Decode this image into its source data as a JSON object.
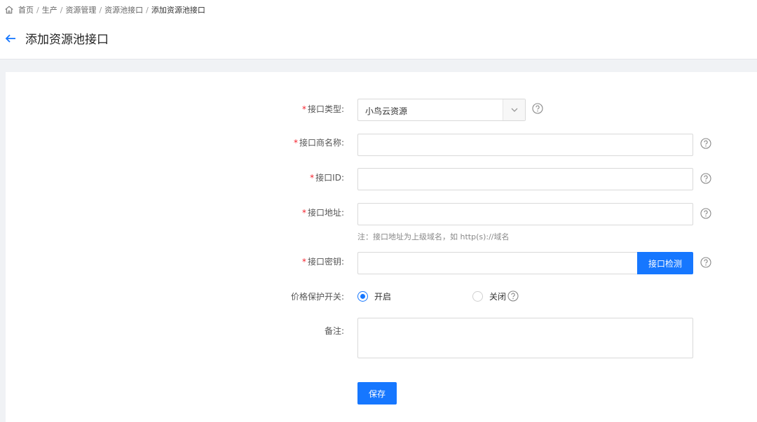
{
  "breadcrumb": {
    "items": [
      "首页",
      "生产",
      "资源管理",
      "资源池接口",
      "添加资源池接口"
    ],
    "separator": "/"
  },
  "header": {
    "title": "添加资源池接口"
  },
  "form": {
    "required_mark": "*",
    "interface_type": {
      "label": "接口类型:",
      "value": "小鸟云资源"
    },
    "vendor_name": {
      "label": "接口商名称:",
      "value": ""
    },
    "interface_id": {
      "label": "接口ID:",
      "value": ""
    },
    "interface_address": {
      "label": "接口地址:",
      "value": "",
      "hint": "注：接口地址为上级域名，如 http(s)://域名"
    },
    "interface_key": {
      "label": "接口密钥:",
      "value": "",
      "check_button": "接口检测"
    },
    "price_protect": {
      "label": "价格保护开关:",
      "on_label": "开启",
      "off_label": "关闭",
      "selected": "开启"
    },
    "remark": {
      "label": "备注:",
      "value": ""
    },
    "save_button": "保存"
  },
  "colors": {
    "accent": "#1677ff",
    "required": "#f5222d"
  },
  "icons": [
    "home-icon",
    "back-arrow-icon",
    "chevron-down-icon",
    "help-icon"
  ]
}
